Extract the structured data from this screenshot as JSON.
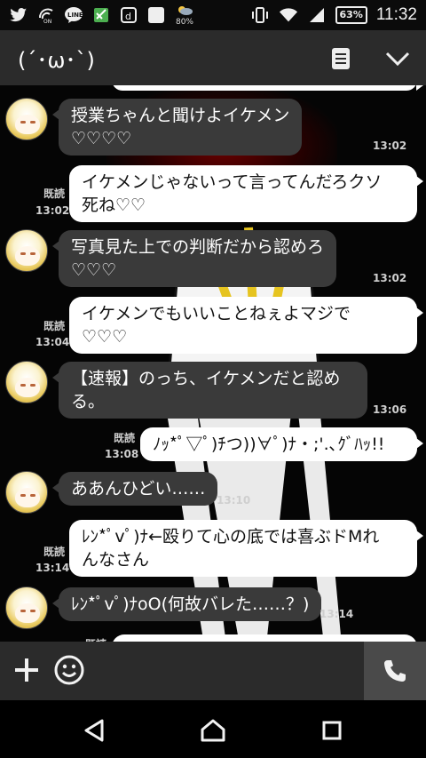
{
  "status_bar": {
    "weather_pct": "80%",
    "battery": "63%",
    "time": "11:32",
    "icons": [
      "twitter-icon",
      "wifi-calling-icon",
      "line-icon",
      "app-icon",
      "dmenu-icon",
      "square-app-icon",
      "weather-icon",
      "vibrate-icon",
      "wifi-icon",
      "signal-icon"
    ]
  },
  "header": {
    "title": "(´･ω･`)",
    "menu_icon": "notes-icon",
    "collapse_icon": "chevron-down-icon"
  },
  "messages": [
    {
      "side": "left",
      "lines": [
        "授業ちゃんと聞けよイケメン",
        "♡♡♡♡"
      ],
      "time": "13:02"
    },
    {
      "side": "right",
      "lines": [
        "イケメンじゃないって言ってんだろクソ",
        "死ね♡♡"
      ],
      "read": "既読",
      "time": "13:02"
    },
    {
      "side": "left",
      "lines": [
        "写真見た上での判断だから認めろ",
        "♡♡♡"
      ],
      "time": "13:02"
    },
    {
      "side": "right",
      "lines": [
        "イケメンでもいいことねぇよマジで",
        "♡♡♡"
      ],
      "read": "既読",
      "time": "13:04"
    },
    {
      "side": "left",
      "lines": [
        "【速報】のっち、イケメンだと認め",
        "る。"
      ],
      "time": "13:06"
    },
    {
      "side": "right",
      "lines": [
        "ﾉｯ*ﾟ▽ﾟ)ﾁつ))∀ﾟ)ﾅ・;'.､ｸﾞﾊｯ!!"
      ],
      "read": "既読",
      "time": "13:08"
    },
    {
      "side": "left",
      "lines": [
        "ああんひどい……"
      ],
      "time": "13:10"
    },
    {
      "side": "right",
      "lines": [
        "ﾚﾝ*ﾟvﾟ)ﾅ←殴りて心の底では喜ぶドMれ",
        "んなさん"
      ],
      "read": "既読",
      "time": "13:14"
    },
    {
      "side": "left",
      "lines": [
        "ﾚﾝ*ﾟvﾟ)ﾅoO(何故バレた……？)"
      ],
      "time": "13:14"
    },
    {
      "side": "right",
      "lines": [
        ""
      ],
      "read": "既読",
      "time": ""
    }
  ],
  "input_bar": {
    "plus_icon": "plus-icon",
    "emoji_icon": "smiley-icon",
    "call_icon": "phone-icon"
  },
  "nav": {
    "back_icon": "back-triangle-icon",
    "home_icon": "home-icon",
    "recents_icon": "recents-square-icon"
  }
}
